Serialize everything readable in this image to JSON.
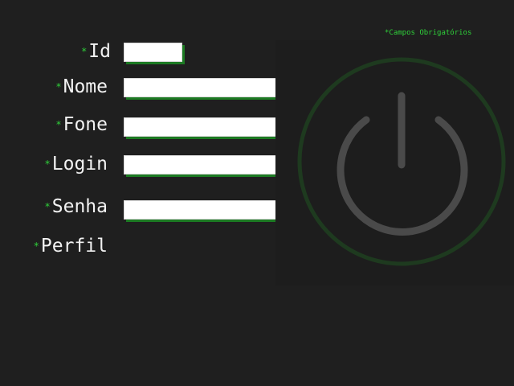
{
  "form": {
    "required_note": "*Campos Obrigatórios",
    "required_mark": "*",
    "fields": [
      {
        "label": "Id",
        "value": "",
        "placeholder": ""
      },
      {
        "label": "Nome",
        "value": "",
        "placeholder": ""
      },
      {
        "label": "Fone",
        "value": "",
        "placeholder": ""
      },
      {
        "label": "Login",
        "value": "",
        "placeholder": ""
      },
      {
        "label": "Senha",
        "value": "",
        "placeholder": ""
      },
      {
        "label": "Perfil"
      }
    ]
  },
  "power_button": {
    "icon": "power-icon"
  },
  "colors": {
    "background": "#1f1f1f",
    "accent_green": "#2fd13a",
    "input_shadow": "#1c7a23",
    "power_ring": "#1e3a1f",
    "power_symbol": "#4a4a4a"
  }
}
